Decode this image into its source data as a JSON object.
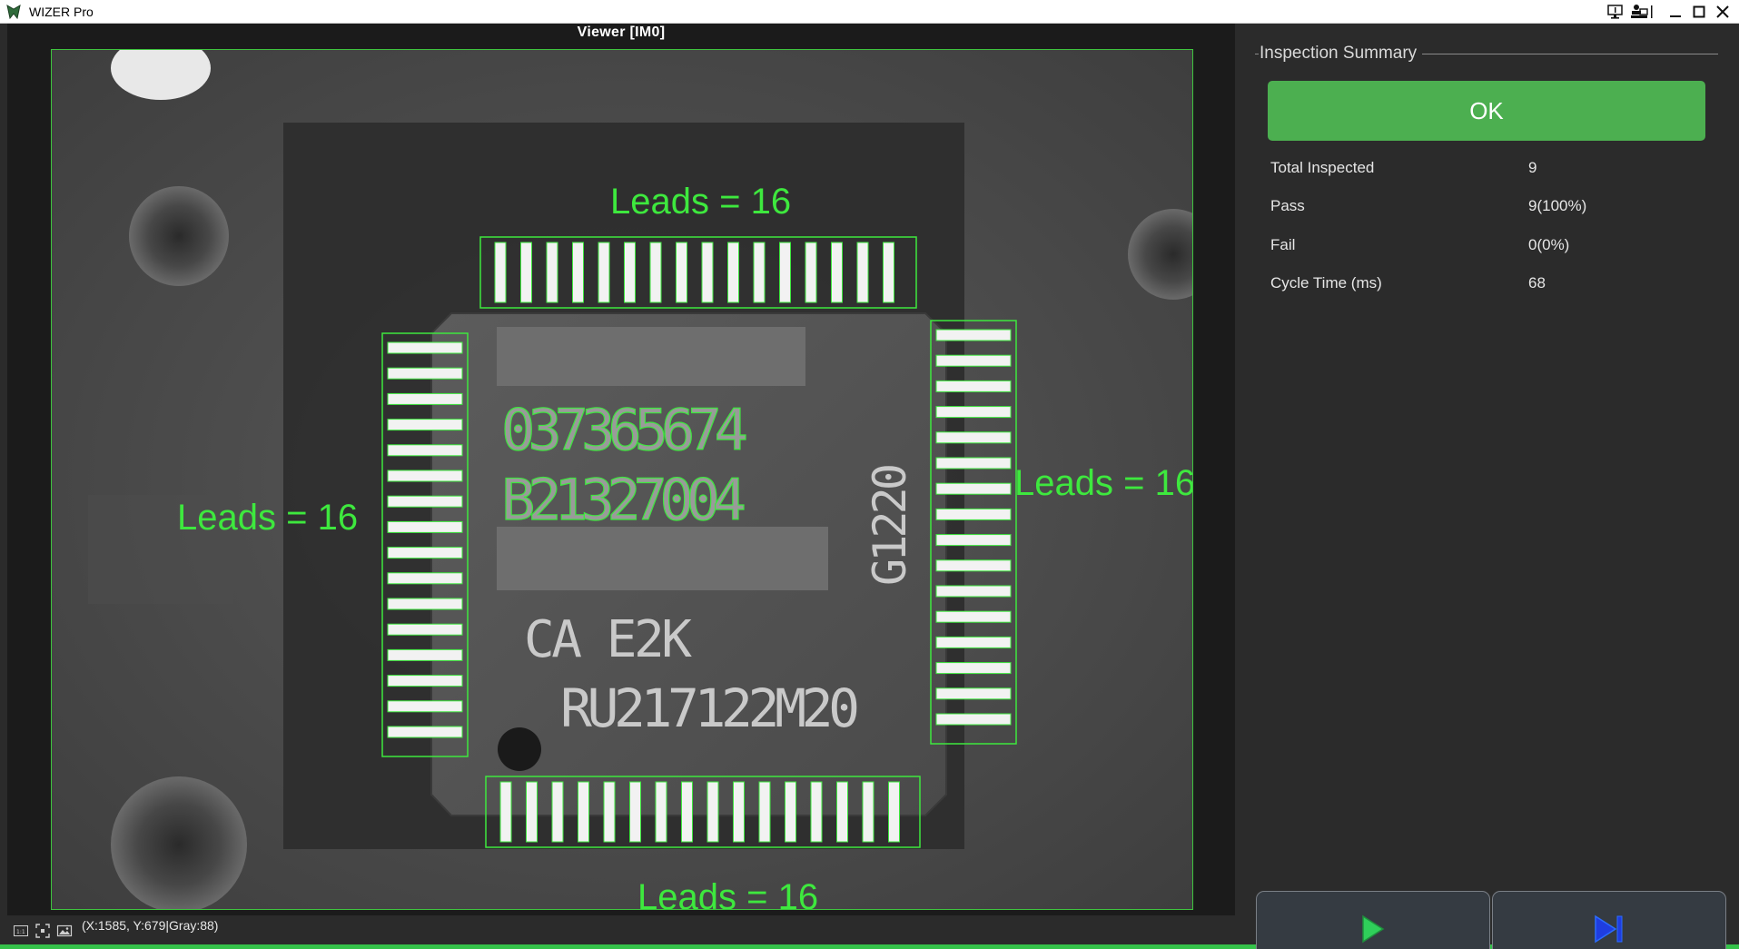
{
  "window": {
    "title": "WIZER Pro"
  },
  "viewer": {
    "title": "Viewer  [IM0]",
    "overlays": {
      "top_leads": "Leads = 16",
      "left_leads": "Leads = 16",
      "right_leads": "Leads = 16",
      "bottom_leads": "Leads = 16"
    },
    "chip_marking": {
      "line1": "037365674",
      "line2": "B21327004",
      "line3": "CA E2K",
      "line4": "RU217122M20",
      "side": "G1220"
    }
  },
  "status_bar": {
    "readout": "(X:1585, Y:679|Gray:88)"
  },
  "summary": {
    "group_title": "Inspection Summary",
    "result": "OK",
    "stats": [
      {
        "label": "Total Inspected",
        "value": "9"
      },
      {
        "label": "Pass",
        "value": "9(100%)"
      },
      {
        "label": "Fail",
        "value": "0(0%)"
      },
      {
        "label": "Cycle Time (ms)",
        "value": "68"
      }
    ]
  },
  "colors": {
    "overlay_green": "#3ee83e",
    "ok_green": "#4caf50",
    "run_icon": "#2fcf5a",
    "step_icon": "#1f3de0",
    "panel_bg": "#2b2b2b"
  },
  "icons": {
    "run_button": "play-icon",
    "step_button": "step-forward-icon"
  }
}
